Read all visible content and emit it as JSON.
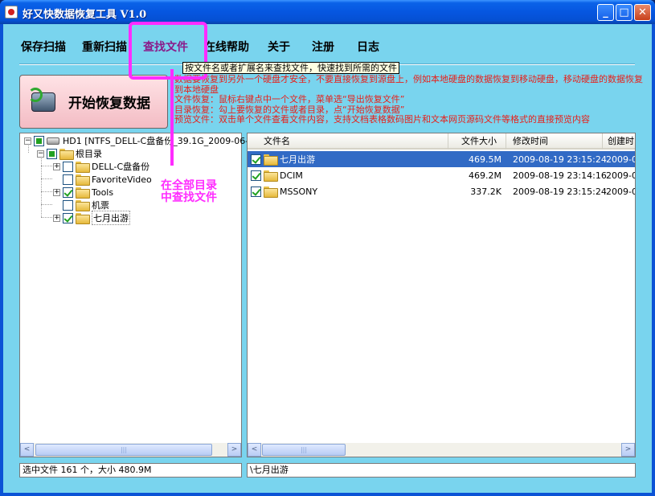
{
  "window": {
    "title": "好又快数据恢复工具 V1.0",
    "min_label": "_",
    "max_label": "□",
    "close_label": "✕"
  },
  "menu": {
    "items": [
      "保存扫描",
      "重新扫描",
      "查找文件",
      "在线帮助",
      "关于",
      "注册",
      "日志"
    ]
  },
  "tooltip": "按文件名或者扩展名来查找文件，快速找到所需的文件",
  "start_button": {
    "label": "开始恢复数据"
  },
  "info_lines": [
    "数据要恢复到另外一个硬盘才安全，不要直接恢复到源盘上，例如本地硬盘的数据恢复到移动硬盘，移动硬盘的数据恢复到本地硬盘",
    "文件恢复：鼠标右键点中一个文件，菜单选“导出恢复文件”",
    "目录恢复：勾上要恢复的文件或者目录，点“开始恢复数据”",
    "预览文件：双击单个文件查看文件内容，支持文档表格数码图片和文本网页源码文件等格式的直接预览内容"
  ],
  "tree": {
    "drive": "HD1  [NTFS_DELL-C盘备份_39.1G_2009-06-1",
    "root": "根目录",
    "children": [
      "DELL-C盘备份",
      "FavoriteVideo",
      "Tools",
      "机票",
      "七月出游"
    ]
  },
  "annotation": {
    "line1": "在全部目录",
    "line2": "中查找文件"
  },
  "list": {
    "columns": [
      "文件名",
      "文件大小",
      "修改时间",
      "创建时"
    ],
    "rows": [
      {
        "name": "七月出游",
        "size": "469.5M",
        "modified": "2009-08-19 23:15:24",
        "created": "2009-0"
      },
      {
        "name": "DCIM",
        "size": "469.2M",
        "modified": "2009-08-19 23:14:16",
        "created": "2009-0"
      },
      {
        "name": "MSSONY",
        "size": "337.2K",
        "modified": "2009-08-19 23:15:24",
        "created": "2009-0"
      }
    ]
  },
  "scroll_arrows": {
    "left": "<",
    "right": ">"
  },
  "scroll_grip": "|||",
  "status": {
    "left": "选中文件 161 个，大小 480.9M",
    "right": "\\七月出游"
  },
  "colors": {
    "titlebar": "#0656e0",
    "client": "#79d4ee",
    "highlight": "#ff2cff",
    "info_text": "#e8201a",
    "selection": "#316ac5"
  }
}
